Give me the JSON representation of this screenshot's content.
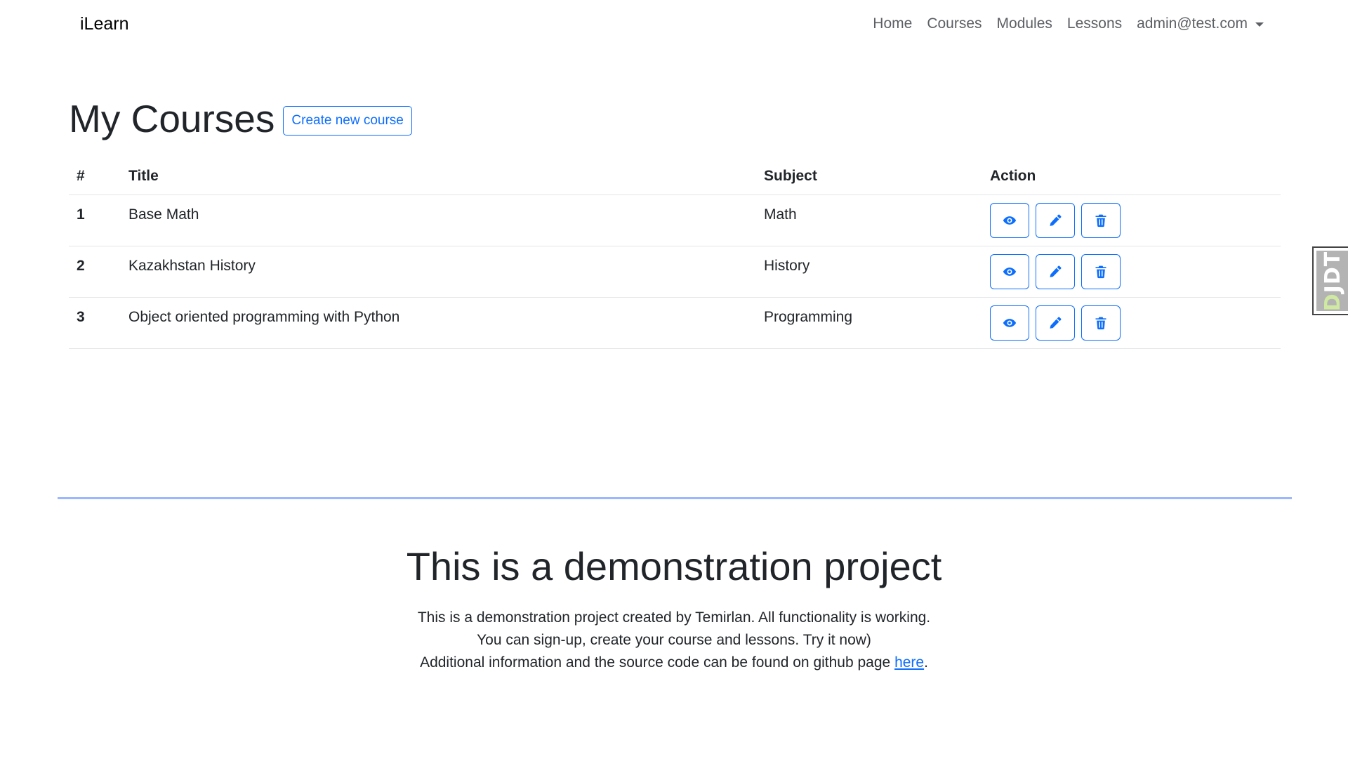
{
  "navbar": {
    "brand": "iLearn",
    "links": [
      "Home",
      "Courses",
      "Modules",
      "Lessons"
    ],
    "user": "admin@test.com"
  },
  "page": {
    "title": "My Courses",
    "create_button": "Create new course"
  },
  "table": {
    "headers": [
      "#",
      "Title",
      "Subject",
      "Action"
    ],
    "rows": [
      {
        "num": "1",
        "title": "Base Math",
        "subject": "Math"
      },
      {
        "num": "2",
        "title": "Kazakhstan History",
        "subject": "History"
      },
      {
        "num": "3",
        "title": "Object oriented programming with Python",
        "subject": "Programming"
      }
    ],
    "action_icons": [
      "eye-icon",
      "pencil-icon",
      "trash-icon"
    ]
  },
  "footer": {
    "title": "This is a demonstration project",
    "line1": "This is a demonstration project created by Temirlan. All functionality is working.",
    "line2": "You can sign-up, create your course and lessons. Try it now)",
    "line3_prefix": "Additional information and the source code can be found on github page ",
    "line3_link": "here",
    "line3_suffix": "."
  },
  "djdt": {
    "label_d": "D",
    "label_rest": "JDT"
  },
  "colors": {
    "primary": "#0d6efd",
    "divider": "#9bb7ff"
  }
}
